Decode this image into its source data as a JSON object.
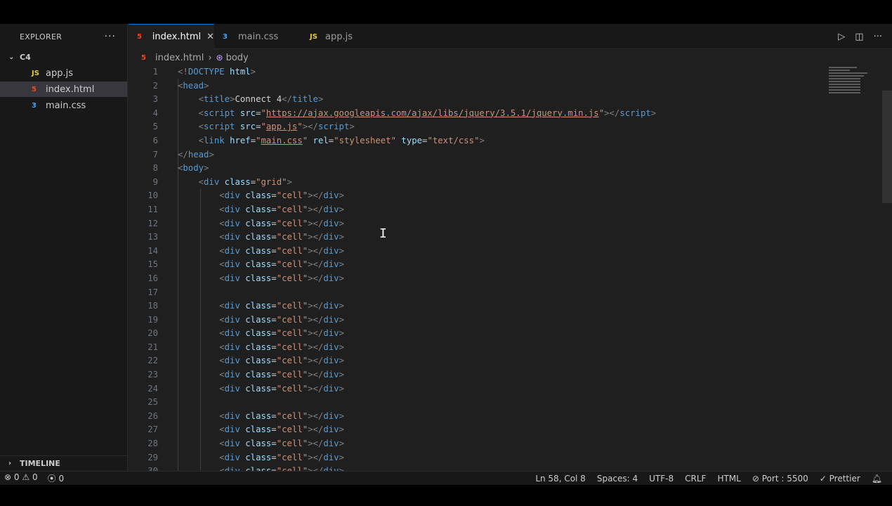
{
  "sidebar": {
    "title": "EXPLORER",
    "more": "···",
    "root": "C4",
    "files": [
      {
        "name": "app.js",
        "icon": "JS"
      },
      {
        "name": "index.html",
        "icon": "5"
      },
      {
        "name": "main.css",
        "icon": "3"
      }
    ],
    "timeline": "TIMELINE"
  },
  "tabs": [
    {
      "label": "index.html",
      "icon": "5"
    },
    {
      "label": "main.css",
      "icon": "3"
    },
    {
      "label": "app.js",
      "icon": "JS"
    }
  ],
  "tab_close": "✕",
  "breadcrumb": {
    "file": "index.html",
    "symbol": "body"
  },
  "code": {
    "l1": "<!DOCTYPE html>",
    "title_text": "Connect 4",
    "jquery_src": "https://ajax.googleapis.com/ajax/libs/jquery/3.5.1/jquery.min.js",
    "app_src": "app.js",
    "css_href": "main.css",
    "grid_class": "\"grid\"",
    "cell_class": "\"cell\""
  },
  "status": {
    "errors": "0",
    "warnings": "0",
    "ports": "0",
    "position": "Ln 58, Col 8",
    "spaces": "Spaces: 4",
    "encoding": "UTF-8",
    "eol": "CRLF",
    "language": "HTML",
    "port": "Port : 5500",
    "formatter": "Prettier"
  },
  "colors": {
    "accent": "#0078d4",
    "html_icon": "#e44d26",
    "css_icon": "#42a5f5",
    "js_icon": "#e5c93a"
  }
}
